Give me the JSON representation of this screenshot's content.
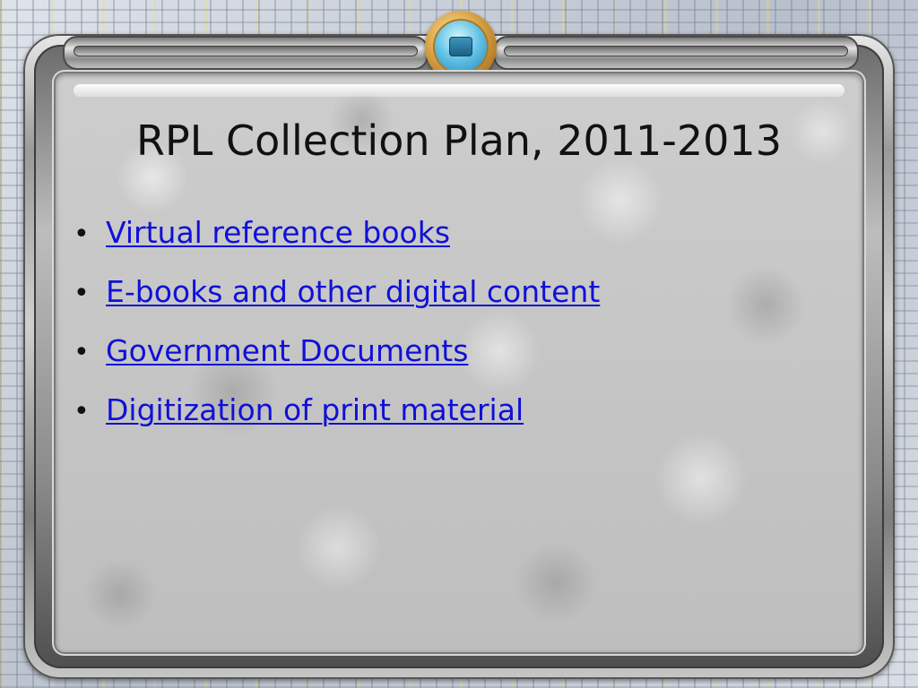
{
  "slide": {
    "title": "RPL Collection Plan, 2011-2013",
    "items": [
      {
        "label": "Virtual reference books"
      },
      {
        "label": "E-books and other digital content"
      },
      {
        "label": "Government Documents"
      },
      {
        "label": "Digitization of print material"
      }
    ]
  },
  "colors": {
    "link": "#1010d8",
    "title": "#111111",
    "panel": "#c4c4c4"
  },
  "icons": {
    "emblem": "circuit-emblem-icon",
    "bullet": "bullet-dot-icon"
  }
}
